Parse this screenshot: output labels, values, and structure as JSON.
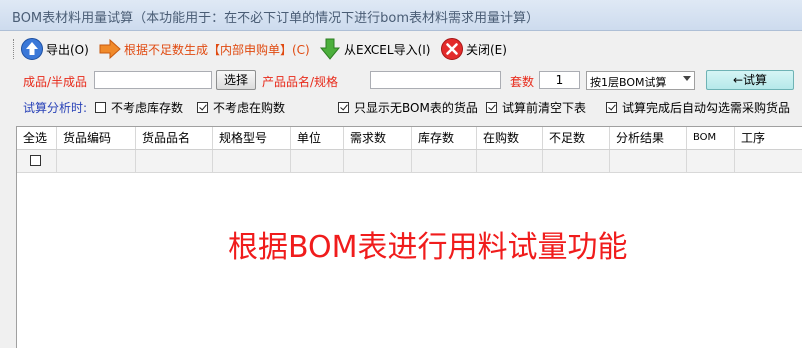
{
  "window": {
    "title": "BOM表材料用量试算（本功能用于：在不必下订单的情况下进行bom表材料需求用量计算）"
  },
  "toolbar": {
    "export_label": "导出(O)",
    "generate_label": "根据不足数生成【内部申购单】(C)",
    "import_label": "从EXCEL导入(I)",
    "close_label": "关闭(E)"
  },
  "form": {
    "product_label": "成品/半成品",
    "product_value": "",
    "select_button": "选择",
    "spec_label": "产品品名/规格",
    "spec_value": "",
    "sets_label": "套数",
    "sets_value": "1",
    "mode_select": "按1层BOM试算",
    "calc_button": "←试算"
  },
  "options": {
    "label": "试算分析时:",
    "items": [
      {
        "label": "不考虑库存数",
        "checked": false
      },
      {
        "label": "不考虑在购数",
        "checked": true
      },
      {
        "label": "只显示无BOM表的货品",
        "checked": true
      },
      {
        "label": "试算前清空下表",
        "checked": true
      },
      {
        "label": "试算完成后自动勾选需采购货品",
        "checked": true
      }
    ]
  },
  "grid": {
    "columns": [
      "全选",
      "货品编码",
      "货品品名",
      "规格型号",
      "单位",
      "需求数",
      "库存数",
      "在购数",
      "不足数",
      "分析结果",
      "BOM",
      "工序"
    ]
  },
  "watermark": "根据BOM表进行用料试量功能"
}
